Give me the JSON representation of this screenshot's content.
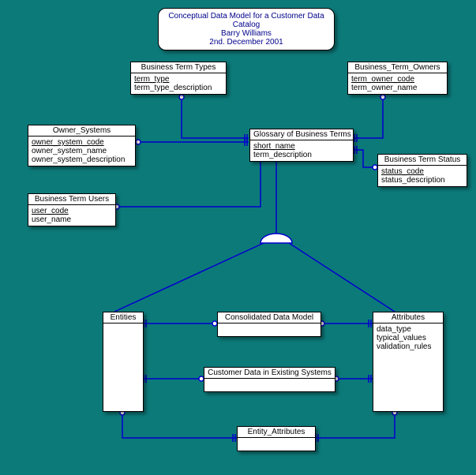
{
  "title": {
    "line1": "Conceptual Data Model for a Customer Data Catalog",
    "line2": "Barry Williams",
    "line3": "2nd. December 2001"
  },
  "entities": {
    "btt": {
      "name": "Business Term Types",
      "pk": "term_type",
      "attrs": [
        "term_type_description"
      ]
    },
    "bto": {
      "name": "Business_Term_Owners",
      "pk": "term_owner_code",
      "attrs": [
        "term_owner_name"
      ]
    },
    "os": {
      "name": "Owner_Systems",
      "pk": "owner_system_code",
      "attrs": [
        "owner_system_name",
        "owner_system_description"
      ]
    },
    "gbt": {
      "name": "Glossary of Business Terms",
      "pk": "short_name",
      "attrs": [
        "term_description"
      ]
    },
    "bts": {
      "name": "Business Term Status",
      "pk": "status_code",
      "attrs": [
        "status_description"
      ]
    },
    "btu": {
      "name": "Business Term Users",
      "pk": "user_code",
      "attrs": [
        "user_name"
      ]
    },
    "ent": {
      "name": "Entities"
    },
    "cdm": {
      "name": "Consolidated Data Model"
    },
    "attr": {
      "name": "Attributes",
      "attrs": [
        "data_type",
        "typical_values",
        "validation_rules"
      ]
    },
    "cdes": {
      "name": "Customer Data in Existing Systems"
    },
    "ea": {
      "name": "Entity_Attributes"
    }
  }
}
